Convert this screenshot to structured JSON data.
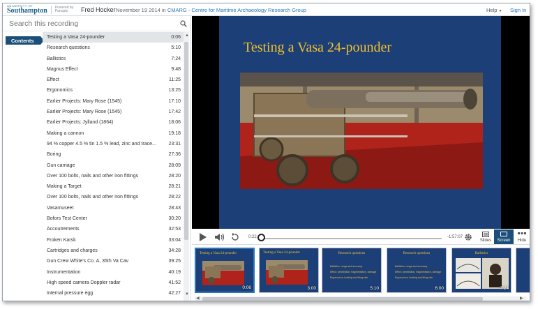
{
  "header": {
    "logo_top": "UNIVERSITY OF",
    "logo_main": "Southampton",
    "powered": "Powered by Panopto",
    "author": "Fred Hocker",
    "date_prefix": "November 19 2014 in",
    "group": "CMARG - Centre for Maritime Archaeology Research Group",
    "help": "Help",
    "signin": "Sign In"
  },
  "search": {
    "placeholder": "Search this recording"
  },
  "sidebar": {
    "contents_label": "Contents"
  },
  "contents": [
    {
      "title": "Testing a Vasa 24-pounder",
      "time": "0:06"
    },
    {
      "title": "Research questions",
      "time": "5:10"
    },
    {
      "title": "Ballistics",
      "time": "7:24"
    },
    {
      "title": "Magnus Effect",
      "time": "9:48"
    },
    {
      "title": "Effect",
      "time": "11:25"
    },
    {
      "title": "Ergonomics",
      "time": "13:25"
    },
    {
      "title": "Earlier Projects: Mary Rose (1545)",
      "time": "17:10"
    },
    {
      "title": "Earlier Projects: Mary Rose (1545)",
      "time": "17:42"
    },
    {
      "title": "Earlier Projects: Jylland (1864)",
      "time": "18:06"
    },
    {
      "title": "Making a cannon",
      "time": "19:18"
    },
    {
      "title": "94 % copper 4.5 % tin 1.5 % lead, zinc and trace...",
      "time": "23:31"
    },
    {
      "title": "Boring",
      "time": "27:36"
    },
    {
      "title": "Gun carriage",
      "time": "28:09"
    },
    {
      "title": "Over 100 bolts, nails and other iron fittings",
      "time": "28:20"
    },
    {
      "title": "Making a Target",
      "time": "28:21"
    },
    {
      "title": "Over 100 bolts, nails and other iron fittings",
      "time": "28:22"
    },
    {
      "title": "Vasamuseet",
      "time": "28:43"
    },
    {
      "title": "Bofors Test Center",
      "time": "30:20"
    },
    {
      "title": "Accoutrements",
      "time": "32:53"
    },
    {
      "title": "Froken Karsk",
      "time": "33:04"
    },
    {
      "title": "Cartridges and charges",
      "time": "34:28"
    },
    {
      "title": "Gun Crew White's Co. A, 35th Va Cav",
      "time": "39:25"
    },
    {
      "title": "Instrumentation",
      "time": "40:19"
    },
    {
      "title": "High speed camera Doppler radar",
      "time": "41:52"
    },
    {
      "title": "Internal pressure egg",
      "time": "42:27"
    }
  ],
  "slide": {
    "title": "Testing a Vasa 24-pounder"
  },
  "player": {
    "current_time": "0:22",
    "remaining_time": "-1:57:07",
    "progress": 0.003,
    "slides_label": "Slides",
    "screen_label": "Screen",
    "hide_label": "Hide"
  },
  "thumbnails": [
    {
      "title": "Testing a Vasa 24-pounder",
      "time": "0:06",
      "lines": []
    },
    {
      "title": "Testing a Vasa 24-pounder",
      "time": "3:00",
      "lines": []
    },
    {
      "title": "Research questions",
      "time": "5:10",
      "lines": [
        "Ballistics: range and accuracy",
        "Effect: penetration, fragmentation, damage",
        "Ergonomics: loading and firing rate"
      ]
    },
    {
      "title": "Research questions",
      "time": "6:00",
      "lines": [
        "Ballistics: range and accuracy",
        "Effect: penetration, fragmentation, damage",
        "Ergonomics: loading and firing rate"
      ]
    },
    {
      "title": "Ballistics",
      "time": "7:24",
      "lines": []
    }
  ],
  "colors": {
    "accent": "#1b4e78",
    "slide_bg": "#1c3f78",
    "slide_title": "#f2c02a",
    "link": "#2b78b8"
  }
}
